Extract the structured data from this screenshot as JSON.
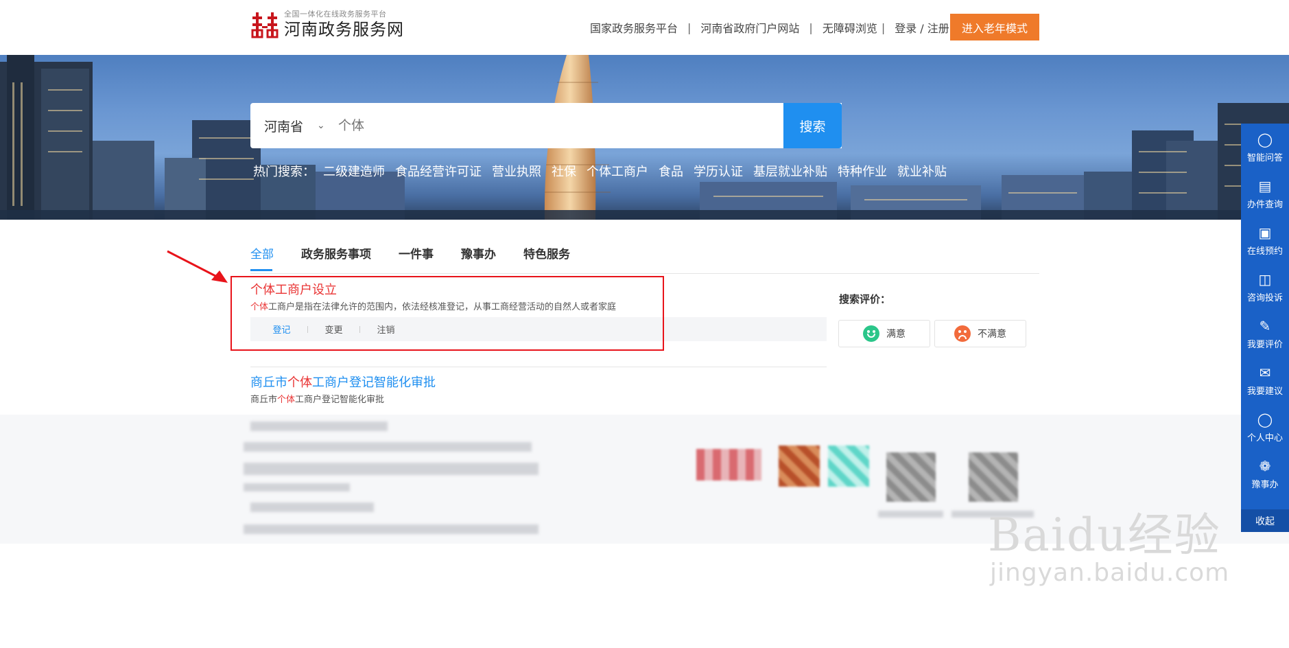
{
  "header": {
    "logo_sub": "全国一体化在线政务服务平台",
    "logo_main": "河南政务服务网",
    "nav": [
      "国家政务服务平台",
      "河南省政府门户网站",
      "无障碍浏览"
    ],
    "login": "登录 / 注册",
    "elder_mode": "进入老年模式"
  },
  "search": {
    "region": "河南省",
    "placeholder": "个体",
    "button": "搜索",
    "hot_label": "热门搜索：",
    "hot_items": [
      "二级建造师",
      "食品经营许可证",
      "营业执照",
      "社保",
      "个体工商户",
      "食品",
      "学历认证",
      "基层就业补贴",
      "特种作业",
      "就业补贴"
    ]
  },
  "tabs": [
    "全部",
    "政务服务事项",
    "一件事",
    "豫事办",
    "特色服务"
  ],
  "results": [
    {
      "title": "个体工商户设立",
      "desc_hl": "个体",
      "desc_rest": "工商户是指在法律允许的范围内，依法经核准登记，从事工商经营活动的自然人或者家庭",
      "actions": [
        "登记",
        "变更",
        "注销"
      ]
    },
    {
      "title_pre": "商丘市",
      "title_hl": "个体",
      "title_post": "工商户登记智能化审批",
      "desc_pre": "商丘市",
      "desc_hl": "个体",
      "desc_post": "工商户登记智能化审批"
    }
  ],
  "evaluation": {
    "title": "搜索评价：",
    "good": "满意",
    "bad": "不满意"
  },
  "sidebar": {
    "items": [
      {
        "label": "智能问答",
        "icon": "robot-icon"
      },
      {
        "label": "办件查询",
        "icon": "document-search-icon"
      },
      {
        "label": "在线预约",
        "icon": "calendar-icon"
      },
      {
        "label": "咨询投诉",
        "icon": "chat-icon"
      },
      {
        "label": "我要评价",
        "icon": "edit-icon"
      },
      {
        "label": "我要建议",
        "icon": "mail-icon"
      },
      {
        "label": "个人中心",
        "icon": "user-icon"
      },
      {
        "label": "豫事办",
        "icon": "yushiban-icon"
      }
    ],
    "collapse": "收起"
  },
  "watermark": {
    "main": "Baidu经验",
    "sub": "jingyan.baidu.com"
  },
  "colors": {
    "brand_blue": "#1f8ff0",
    "highlight_red": "#e93434",
    "elder_orange": "#ef7a2a",
    "sidebar_blue": "#1a61c7",
    "annotation_red": "#e8131a"
  }
}
